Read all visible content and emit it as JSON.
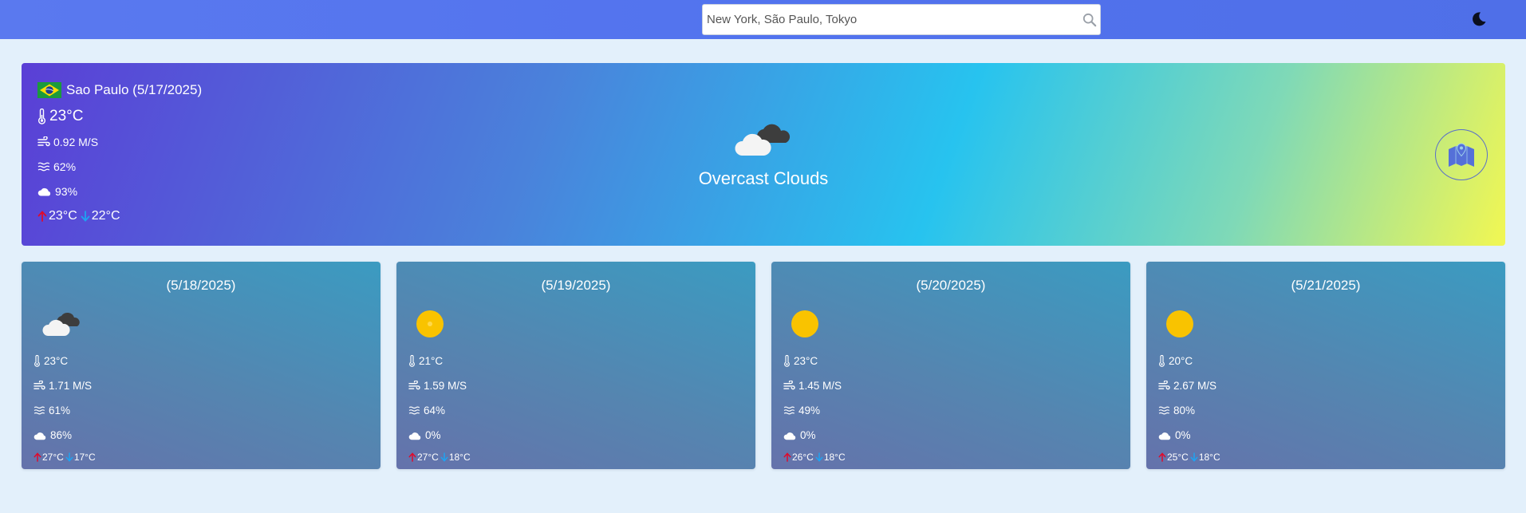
{
  "search": {
    "placeholder": "New York, São Paulo, Tokyo"
  },
  "current": {
    "city": "Sao Paulo (5/17/2025)",
    "temp": "23°C",
    "wind": "0.92 M/S",
    "humidity": "62%",
    "clouds": "93%",
    "max": "23°C",
    "min": "22°C",
    "description": "Overcast Clouds",
    "icon": "overcast-clouds-icon"
  },
  "forecast": [
    {
      "date": "(5/18/2025)",
      "icon": "cloud-icon",
      "temp": "23°C",
      "wind": "1.71 M/S",
      "humidity": "61%",
      "clouds": "86%",
      "max": "27°C",
      "min": "17°C"
    },
    {
      "date": "(5/19/2025)",
      "icon": "sun-icon",
      "temp": "21°C",
      "wind": "1.59 M/S",
      "humidity": "64%",
      "clouds": "0%",
      "max": "27°C",
      "min": "18°C"
    },
    {
      "date": "(5/20/2025)",
      "icon": "sun-icon",
      "temp": "23°C",
      "wind": "1.45 M/S",
      "humidity": "49%",
      "clouds": "0%",
      "max": "26°C",
      "min": "18°C"
    },
    {
      "date": "(5/21/2025)",
      "icon": "sun-icon",
      "temp": "20°C",
      "wind": "2.67 M/S",
      "humidity": "80%",
      "clouds": "0%",
      "max": "25°C",
      "min": "18°C"
    }
  ],
  "colors": {
    "header": "#5273ee",
    "background": "#e3f0fb",
    "max_arrow": "#e00a2c",
    "min_arrow": "#1ea3f2"
  }
}
